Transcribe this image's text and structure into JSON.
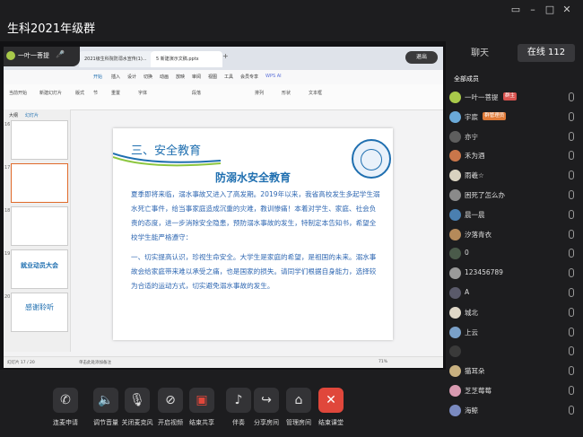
{
  "window": {
    "title": "生科2021年级群",
    "controls": [
      "screen-icon",
      "minimize-icon",
      "maximize-icon",
      "close-icon"
    ]
  },
  "presenter": {
    "name": "一叶一菩提"
  },
  "wps": {
    "tabs": [
      "2021级生科院防溺水宣传(1)...",
      "5 新建演示文稿.pptx"
    ],
    "exit_fullscreen": "退出",
    "menus": [
      "开始",
      "插入",
      "设计",
      "切换",
      "动画",
      "放映",
      "审阅",
      "视图",
      "工具",
      "会员专享",
      "WPS AI"
    ],
    "toolbar_items": [
      "当前开始",
      "新建幻灯片",
      "版式",
      "节",
      "重置",
      "字体",
      "段落",
      "排列",
      "形状",
      "文本框"
    ],
    "panel_tabs": [
      "大纲",
      "幻灯片"
    ],
    "slide_numbers": [
      "16",
      "17",
      "18",
      "19",
      "20"
    ],
    "thumb_texts": [
      "就业动员大会",
      "感谢聆听"
    ],
    "status": {
      "slide_info": "幻灯片 17 / 20",
      "notes_hint": "单击此处添加备注",
      "zoom": "71%"
    }
  },
  "slide": {
    "section": "三、安全教育",
    "title": "防溺水安全教育",
    "para1": "夏季即将来临，溺水事故又进入了高发期。2019年以来，我省高校发生多起学生溺水死亡事件，给当事家庭造成沉重的灾难，教训惨痛！本着对学生、家庭、社会负责的态度，进一步消除安全隐患，预防溺水事故的发生，特制定本告知书，希望全校学生能严格遵守：",
    "para2": "一、切实提高认识，珍视生命安全。大学生是家庭的希望，是祖国的未来。溺水事故会给家庭带来难以承受之痛，也是国家的损失。请同学们根据自身能力，选择较为合适的运动方式，切实避免溺水事故的发生。"
  },
  "controls_bar": [
    {
      "label": "连麦申请",
      "icon": "phone-icon"
    },
    {
      "label": "调节音量",
      "icon": "speaker-icon"
    },
    {
      "label": "关闭麦克风",
      "icon": "mic-icon"
    },
    {
      "label": "开启视频",
      "icon": "video-off-icon"
    },
    {
      "label": "结束共享",
      "icon": "share-screen-icon"
    },
    {
      "label": "伴奏",
      "icon": "music-icon"
    },
    {
      "label": "分享房间",
      "icon": "share-icon"
    },
    {
      "label": "管理房间",
      "icon": "home-gear-icon"
    },
    {
      "label": "结束课堂",
      "icon": "close-icon"
    }
  ],
  "side": {
    "chat_tab": "聊天",
    "online_tab": "在线 112",
    "all_members": "全部成员",
    "members": [
      {
        "name": "一叶一菩提",
        "badge": "群主",
        "badge_color": "#d9534f",
        "avatar": "#a8c94a"
      },
      {
        "name": "宇宸",
        "badge": "群管理员",
        "badge_color": "#e07b39",
        "avatar": "#6aa9d8"
      },
      {
        "name": "亦宁",
        "badge": "",
        "avatar": "#5e5e5e"
      },
      {
        "name": "禾为酒",
        "badge": "",
        "avatar": "#c9764a"
      },
      {
        "name": "雨羲☆",
        "badge": "",
        "avatar": "#d9d2c0"
      },
      {
        "name": "困死了怎么办",
        "badge": "",
        "avatar": "#8a8a8a"
      },
      {
        "name": "晨一晨",
        "badge": "",
        "avatar": "#4a7fb0"
      },
      {
        "name": "汐落青衣",
        "badge": "",
        "avatar": "#b58a5a"
      },
      {
        "name": "0",
        "badge": "",
        "avatar": "#4a5a4a"
      },
      {
        "name": "123456789",
        "badge": "",
        "avatar": "#9a9a9a"
      },
      {
        "name": "A",
        "badge": "",
        "avatar": "#5a5a6a"
      },
      {
        "name": "城北",
        "badge": "",
        "avatar": "#e0d8c8"
      },
      {
        "name": "上云",
        "badge": "",
        "avatar": "#7aa0c8"
      },
      {
        "name": "",
        "badge": "",
        "avatar": "#3a3a3a"
      },
      {
        "name": "猫耳朵",
        "badge": "",
        "avatar": "#c8b080"
      },
      {
        "name": "芝芝莓莓",
        "badge": "",
        "avatar": "#d89ab0"
      },
      {
        "name": "海鲸",
        "badge": "",
        "avatar": "#7a8ac0"
      }
    ]
  }
}
